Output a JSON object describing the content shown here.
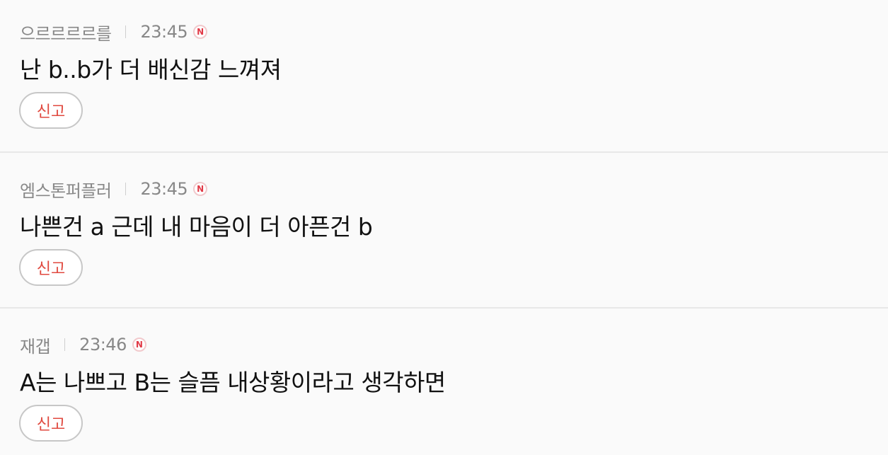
{
  "comments": [
    {
      "nickname": "으르르르르를",
      "time": "23:45",
      "badge": "N",
      "text": "난 b..b가 더 배신감 느껴져",
      "report_label": "신고"
    },
    {
      "nickname": "엠스톤퍼플러",
      "time": "23:45",
      "badge": "N",
      "text": "나쁜건 a 근데 내 마음이 더 아픈건 b",
      "report_label": "신고"
    },
    {
      "nickname": "재갭",
      "time": "23:46",
      "badge": "N",
      "text": "A는 나쁘고 B는 슬픔 내상황이라고 생각하면",
      "report_label": "신고"
    }
  ],
  "colors": {
    "background": "#fafafa",
    "meta_text": "#888888",
    "body_text": "#111111",
    "report_text": "#e0493f",
    "badge": "#e13a47",
    "divider": "#e8e8e8"
  }
}
